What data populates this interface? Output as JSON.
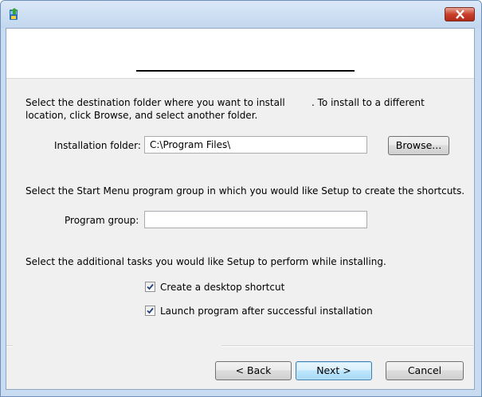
{
  "title_bar": {
    "icon": "setup-app-icon",
    "close_icon": "close-x-icon"
  },
  "intro": {
    "line1": "Select the destination folder where you want to install",
    "line1_suffix": ". To install to a different",
    "line2": "location, click Browse, and select another folder."
  },
  "install_folder": {
    "label": "Installation folder:",
    "value": "C:\\Program Files\\",
    "browse_label": "Browse..."
  },
  "start_menu": {
    "instruction": "Select the Start Menu program group in which you would like Setup to create the shortcuts.",
    "label": "Program group:",
    "value": ""
  },
  "tasks": {
    "instruction": "Select the additional tasks you would like Setup to perform while installing.",
    "items": [
      {
        "label": "Create a desktop shortcut",
        "checked": true
      },
      {
        "label": "Launch program after successful installation",
        "checked": true
      }
    ]
  },
  "footer": {
    "back_label": "< Back",
    "next_label": "Next >",
    "cancel_label": "Cancel"
  },
  "colors": {
    "title_bar": "#c2d7ef",
    "close_button": "#c9402b",
    "client_bg": "#f0f0f0",
    "default_button_border": "#3c7fb1"
  }
}
